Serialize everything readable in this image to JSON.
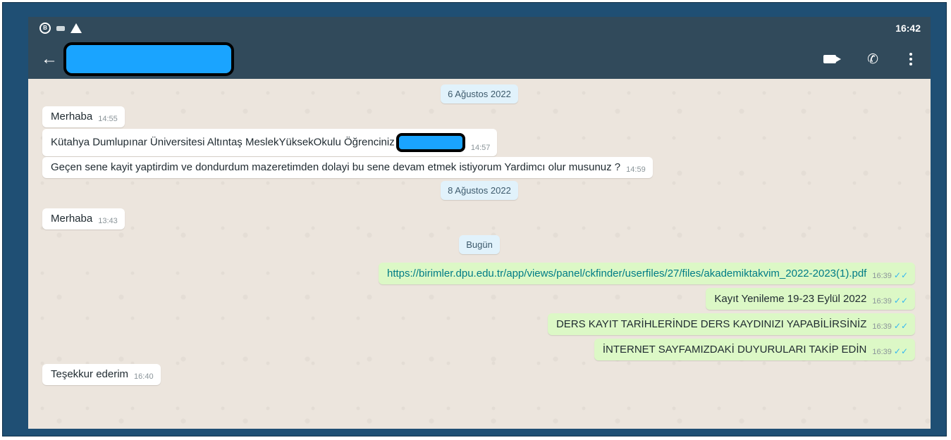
{
  "status_bar": {
    "time": "16:42",
    "icons": [
      "b-icon",
      "message-icon",
      "warning-icon"
    ]
  },
  "app_bar": {
    "back_icon": "arrow-left-icon",
    "contact_name_redacted": true,
    "action_icons": [
      "video-call-icon",
      "phone-call-icon",
      "more-vert-icon"
    ]
  },
  "chat": {
    "dates": {
      "first": "6 Ağustos 2022",
      "second": "8 Ağustos 2022",
      "third": "Bugün"
    },
    "messages": [
      {
        "direction": "in",
        "text": "Merhaba",
        "time": "14:55"
      },
      {
        "direction": "in",
        "text": "Kütahya Dumlupınar Üniversitesi Altıntaş MeslekYüksekOkulu  Öğrenciniz",
        "time": "14:57"
      },
      {
        "direction": "in",
        "text": "Geçen sene kayit yaptirdim ve dondurdum mazeretimden dolayi bu sene devam etmek istiyorum Yardimcı olur musunuz ?",
        "time": "14:59"
      },
      {
        "direction": "in",
        "text": "Merhaba",
        "time": "13:43"
      },
      {
        "direction": "out",
        "text": "https://birimler.dpu.edu.tr/app/views/panel/ckfinder/userfiles/27/files/akademiktakvim_2022-2023(1).pdf",
        "time": "16:39"
      },
      {
        "direction": "out",
        "text": "Kayıt Yenileme 19-23 Eylül 2022",
        "time": "16:39"
      },
      {
        "direction": "out",
        "text": "DERS KAYIT TARİHLERİNDE DERS KAYDINIZI YAPABİLİRSİNİZ",
        "time": "16:39"
      },
      {
        "direction": "out",
        "text": "İNTERNET SAYFAMIZDAKİ DUYURULARI TAKİP EDİN",
        "time": "16:39"
      },
      {
        "direction": "in",
        "text": "Teşekkur ederim",
        "time": "16:40"
      }
    ],
    "read_ticks": "✓✓"
  },
  "colors": {
    "frame": "#1f4f74",
    "header": "#314a5b",
    "incoming": "#ffffff",
    "outgoing": "#dcf8c6",
    "tick": "#34b7f1",
    "redaction": "#1aa4ff"
  }
}
